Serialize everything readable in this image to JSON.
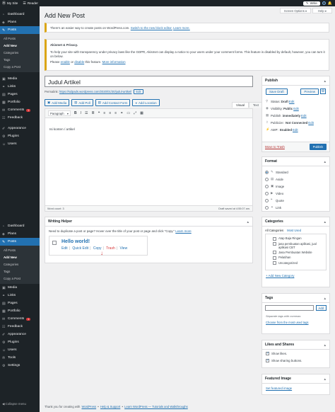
{
  "topbar": {
    "mysite": "My Site",
    "reader": "Reader",
    "write": "Write"
  },
  "sidebar": {
    "top": [
      {
        "label": "Dashboard",
        "icon": "dashboard-icon"
      },
      {
        "label": "Plans",
        "icon": "plans-icon"
      }
    ],
    "posts_label": "Posts",
    "posts_sub": [
      "All Posts",
      "Add New",
      "Categories",
      "Tags",
      "Copy a Post"
    ],
    "rest": [
      {
        "label": "Media",
        "icon": "media-icon"
      },
      {
        "label": "Links",
        "icon": "links-icon"
      },
      {
        "label": "Pages",
        "icon": "pages-icon"
      },
      {
        "label": "Portfolio",
        "icon": "portfolio-icon"
      },
      {
        "label": "Comments",
        "icon": "comments-icon",
        "badge": "1"
      },
      {
        "label": "Feedback",
        "icon": "feedback-icon"
      }
    ],
    "rest2": [
      {
        "label": "Appearance",
        "icon": "appearance-icon"
      },
      {
        "label": "Plugins",
        "icon": "plugins-icon"
      },
      {
        "label": "Users",
        "icon": "users-icon"
      }
    ],
    "rest2b": [
      {
        "label": "Tools",
        "icon": "tools-icon"
      },
      {
        "label": "Settings",
        "icon": "settings-icon"
      }
    ],
    "collapse": "Collapse menu"
  },
  "header": {
    "title": "Add New Post",
    "screen_options": "Screen Options ▾",
    "help": "Help ▾"
  },
  "notice1": {
    "text": "There's an easier way to create posts on WordPress.com.",
    "link": "Switch to the new block editor.",
    "learn": "Learn more."
  },
  "notice2": {
    "title": "Akismet & Privacy.",
    "text": "To help your site with transparency under privacy laws like the GDPR, Akismet can display a notice to your users under your comment forms. This feature is disabled by default, however, you can turn it on below.",
    "please": "Please",
    "enable": "enable",
    "or": "or",
    "disable": "disable",
    "this_feature": "this feature.",
    "more_info": "More information"
  },
  "editor": {
    "title_value": "Judul Artikel",
    "permalink_label": "Permalink:",
    "permalink_url": "https://sidpads.wordpress.com/2020/01/30/judul-artikel/",
    "permalink_edit": "Edit",
    "media_buttons": [
      {
        "label": "Add Media",
        "icon": "media-icon"
      },
      {
        "label": "Add Poll",
        "icon": "poll-icon"
      },
      {
        "label": "Add Contact Form",
        "icon": "form-icon"
      },
      {
        "label": "Add Location",
        "icon": "location-icon"
      }
    ],
    "tab_visual": "Visual",
    "tab_text": "Text",
    "format_select": "Paragraph",
    "content": "Isi konten / artikel",
    "word_count": "Word count: 3",
    "draft_saved": "Draft saved at 4:55:07 am."
  },
  "writing_helper": {
    "title": "Writing Helper",
    "text": "Need to duplicate a post or page? Hover over the title of your post or page and click \"Copy.\"",
    "learn_more": "Learn more",
    "post_title": "Hello world!",
    "edit": "Edit",
    "quick_edit": "Quick Edit",
    "copy": "Copy",
    "trash": "Trash",
    "view": "View"
  },
  "publish": {
    "title": "Publish",
    "save_draft": "Save Draft",
    "preview": "Preview",
    "status_label": "Status:",
    "status_value": "Draft",
    "visibility_label": "Visibility:",
    "visibility_value": "Public",
    "publish_label": "Publish",
    "publish_value": "immediately",
    "publicize_label": "Publicize:",
    "publicize_value": "Not Connected",
    "amp_label": "AMP:",
    "amp_value": "Enabled",
    "edit": "Edit",
    "move_trash": "Move to Trash",
    "publish_btn": "Publish"
  },
  "format": {
    "title": "Format",
    "options": [
      {
        "label": "Standard",
        "icon": "pin-icon",
        "selected": true
      },
      {
        "label": "Aside",
        "icon": "aside-icon",
        "selected": false
      },
      {
        "label": "Image",
        "icon": "image-icon",
        "selected": false
      },
      {
        "label": "Video",
        "icon": "video-icon",
        "selected": false
      },
      {
        "label": "Quote",
        "icon": "quote-icon",
        "selected": false
      },
      {
        "label": "Link",
        "icon": "link-icon",
        "selected": false
      }
    ]
  },
  "categories": {
    "title": "Categories",
    "tab_all": "All Categories",
    "tab_most": "Most Used",
    "items": [
      {
        "label": "Atap Baja Ringan",
        "indent": true,
        "checked": false
      },
      {
        "label": "jasa pembuatan aplikasi, jual aplikasi CBT",
        "indent": true,
        "checked": false
      },
      {
        "label": "Jasa Pembuatan Website",
        "indent": true,
        "checked": false
      },
      {
        "label": "Pelatihan",
        "indent": true,
        "checked": false
      },
      {
        "label": "Uncategorized",
        "indent": true,
        "checked": false
      }
    ],
    "add_new": "+ Add New Category"
  },
  "tags": {
    "title": "Tags",
    "add": "Add",
    "hint": "Separate tags with commas",
    "choose": "Choose from the most used tags"
  },
  "likes": {
    "title": "Likes and Shares",
    "show_likes": "Show likes.",
    "show_sharing": "Show sharing buttons."
  },
  "featured": {
    "title": "Featured Image",
    "set": "Set featured image"
  },
  "footer": {
    "thank": "Thank you for creating with",
    "wp": "WordPress",
    "bullet": "•",
    "help": "Help & Support",
    "learn": "Learn WordPress — Tutorials and Walkthroughs"
  }
}
